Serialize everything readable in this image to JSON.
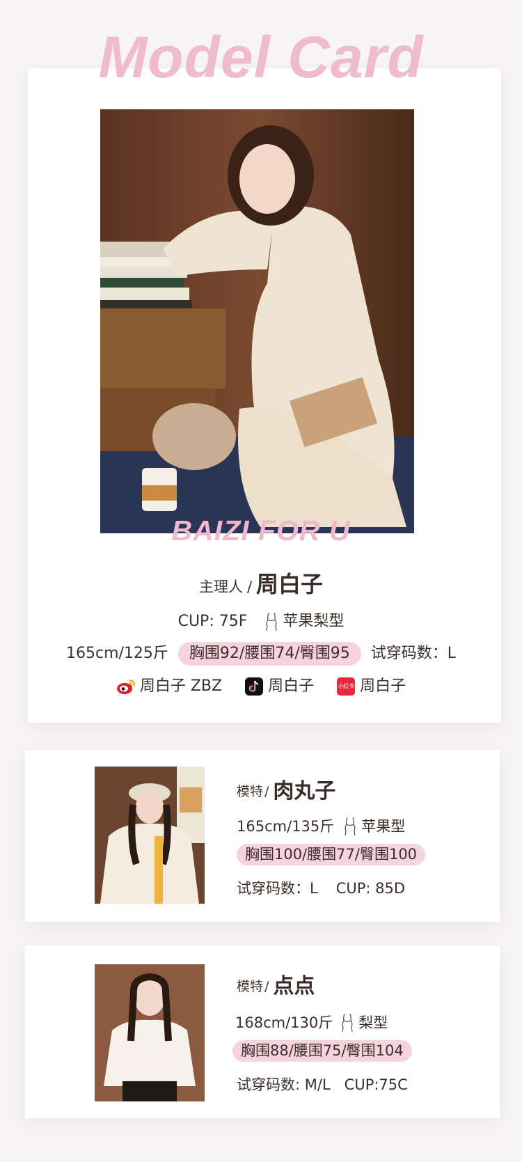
{
  "header": {
    "title": "Model Card"
  },
  "main_card": {
    "watermark": "BAIZI FOR U",
    "owner_prefix": "主理人",
    "owner_sep": "/",
    "owner_name": "周白子",
    "cup": "CUP: 75F",
    "body_type": "苹果梨型",
    "height_weight": "165cm/125斤",
    "measurements": "胸围92/腰围74/臀围95",
    "size": "试穿码数：L",
    "social": {
      "weibo": "周白子 ZBZ",
      "douyin": "周白子",
      "xiaohongshu": "周白子",
      "xiaohongshu_logo_text": "小红书"
    }
  },
  "models": [
    {
      "prefix": "模特",
      "sep": "/",
      "name": "肉丸子",
      "height_weight": "165cm/135斤",
      "body_type": "苹果型",
      "measurements": "胸围100/腰围77/臀围100",
      "size": "试穿码数：L",
      "cup": "CUP: 85D"
    },
    {
      "prefix": "模特",
      "sep": "/",
      "name": "点点",
      "height_weight": "168cm/130斤",
      "body_type": "梨型",
      "measurements": "胸围88/腰围75/臀围104",
      "size": "试穿码数: M/L",
      "cup": "CUP:75C"
    }
  ],
  "colors": {
    "accent_pink": "#eebccb",
    "pill_pink": "#f6d3de",
    "text_dark": "#3a2f2b"
  }
}
